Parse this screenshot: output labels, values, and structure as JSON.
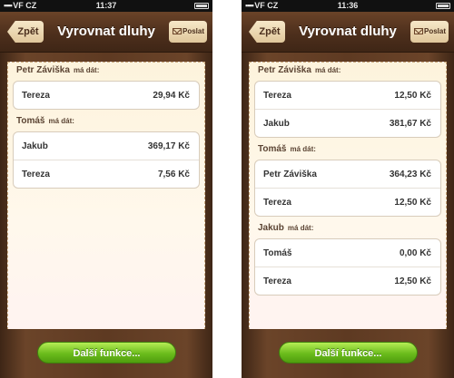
{
  "screens": [
    {
      "status": {
        "carrier": "VF CZ",
        "time": "11:37"
      },
      "nav": {
        "back": "Zpět",
        "title": "Vyrovnat dluhy",
        "share": "Poslat"
      },
      "groups": [
        {
          "name": "Petr Záviška",
          "owes": "má dát:",
          "rows": [
            {
              "name": "Tereza",
              "amount": "29,94 Kč"
            }
          ]
        },
        {
          "name": "Tomáš",
          "owes": "má dát:",
          "rows": [
            {
              "name": "Jakub",
              "amount": "369,17 Kč"
            },
            {
              "name": "Tereza",
              "amount": "7,56 Kč"
            }
          ]
        }
      ],
      "more_button": "Další funkce..."
    },
    {
      "status": {
        "carrier": "VF CZ",
        "time": "11:36"
      },
      "nav": {
        "back": "Zpět",
        "title": "Vyrovnat dluhy",
        "share": "Poslat"
      },
      "groups": [
        {
          "name": "Petr Záviška",
          "owes": "má dát:",
          "rows": [
            {
              "name": "Tereza",
              "amount": "12,50 Kč"
            },
            {
              "name": "Jakub",
              "amount": "381,67 Kč"
            }
          ]
        },
        {
          "name": "Tomáš",
          "owes": "má dát:",
          "rows": [
            {
              "name": "Petr Záviška",
              "amount": "364,23 Kč"
            },
            {
              "name": "Tereza",
              "amount": "12,50 Kč"
            }
          ]
        },
        {
          "name": "Jakub",
          "owes": "má dát:",
          "rows": [
            {
              "name": "Tomáš",
              "amount": "0,00 Kč"
            },
            {
              "name": "Tereza",
              "amount": "12,50 Kč"
            }
          ]
        }
      ],
      "more_button": "Další funkce..."
    }
  ]
}
